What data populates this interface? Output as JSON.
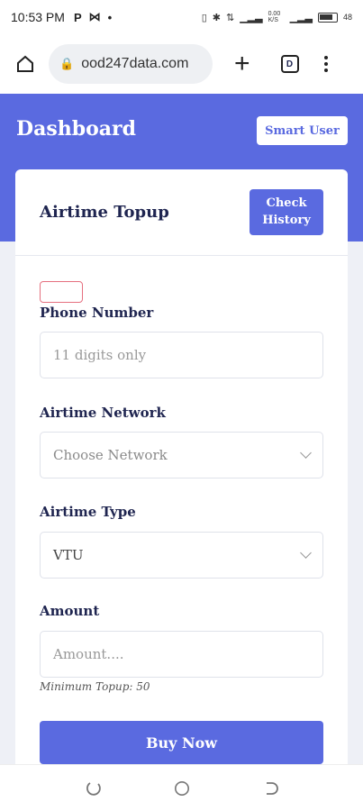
{
  "status_bar": {
    "time": "10:53 PM",
    "icons": [
      "p-icon",
      "mail-icon",
      "dot-icon"
    ],
    "right_icons": [
      "vibrate-icon",
      "bluetooth-icon",
      "data-icon",
      "signal-icon",
      "signal-icon",
      "battery-icon"
    ],
    "speed_text": "0.00 K/S",
    "battery_label": "48"
  },
  "browser": {
    "url": "ood247data.com",
    "tabs_count": "D"
  },
  "header": {
    "title": "Dashboard",
    "user_button": "Smart User"
  },
  "card": {
    "title": "Airtime Topup",
    "history_button": "Check History",
    "phone": {
      "label": "Phone Number",
      "placeholder": "11 digits only"
    },
    "network": {
      "label": "Airtime Network",
      "value": "Choose Network"
    },
    "type": {
      "label": "Airtime Type",
      "value": "VTU"
    },
    "amount": {
      "label": "Amount",
      "placeholder": "Amount....",
      "hint": "Minimum Topup: 50"
    },
    "buy_button": "Buy Now"
  },
  "colors": {
    "accent": "#5a6ae0",
    "alert_border": "#e5707f"
  }
}
